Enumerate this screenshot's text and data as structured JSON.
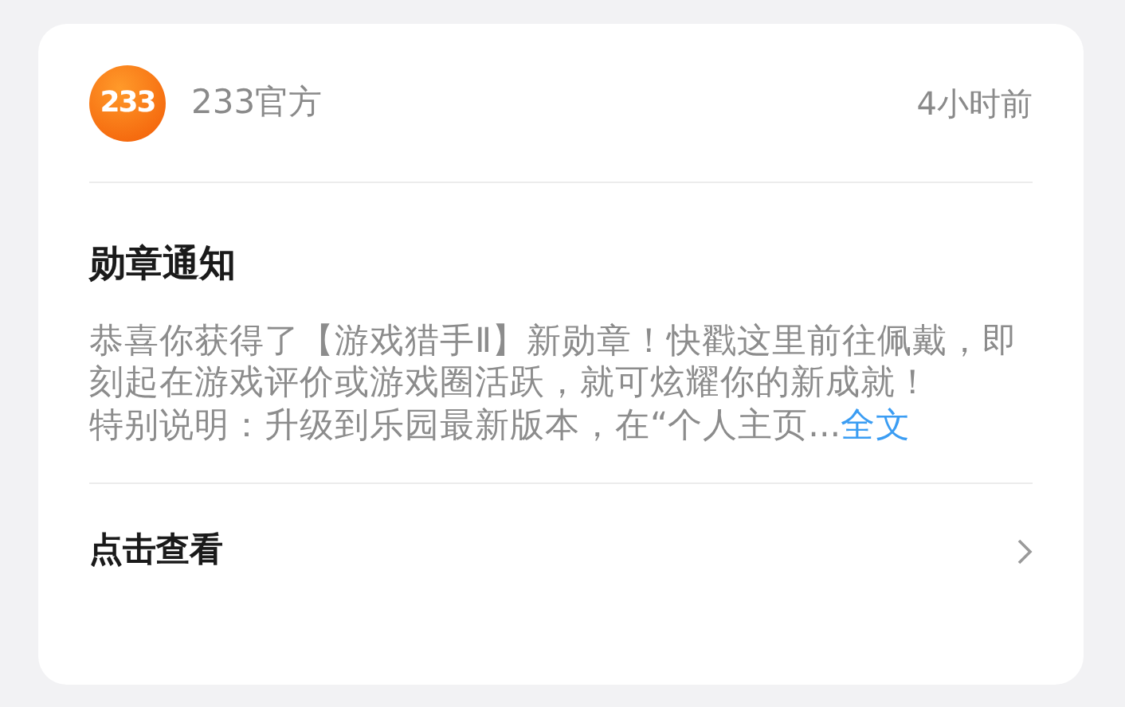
{
  "sender": {
    "logo": "233",
    "name": "233官方",
    "time": "4小时前"
  },
  "notice": {
    "title": "勋章通知",
    "body": "恭喜你获得了【游戏猎手Ⅱ】新勋章！快戳这里前往佩戴，即刻起在游戏评价或游戏圈活跃，就可炫耀你的新成就！",
    "note": "特别说明：升级到乐园最新版本，在“个人主页...",
    "more_link": "全文"
  },
  "action": {
    "label": "点击查看"
  }
}
